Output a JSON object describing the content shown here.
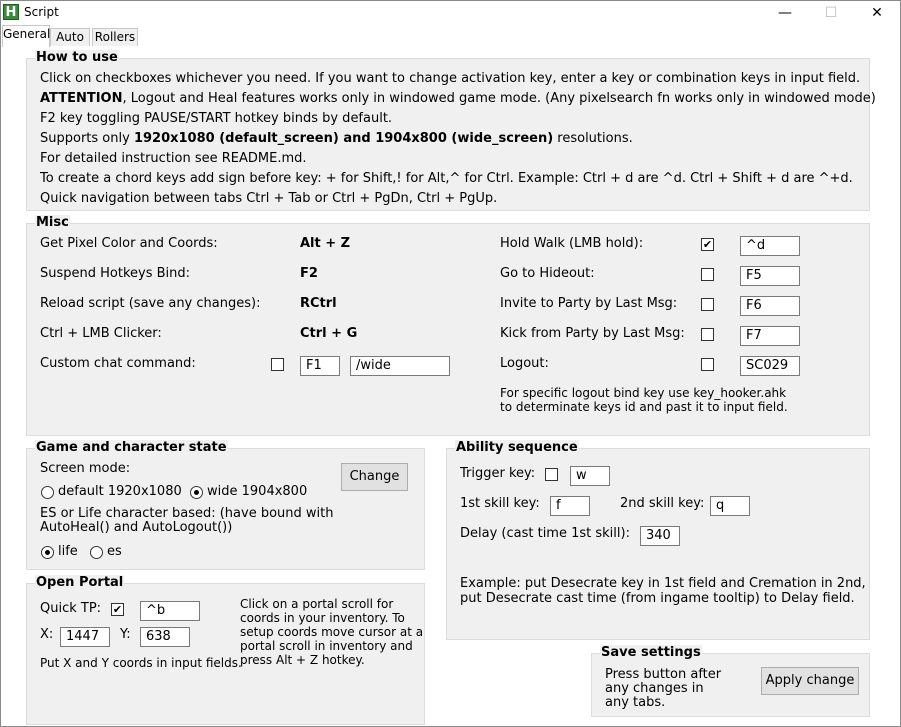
{
  "window": {
    "title": "Script",
    "app_icon_letter": "H",
    "minimize": "—",
    "maximize": "☐",
    "close": "✕"
  },
  "tabs": [
    "General",
    "Auto",
    "Rollers"
  ],
  "how_to_use": {
    "title": "How to use",
    "line1": "Click on checkboxes whichever you need. If you want to change activation key, enter a key or combination keys in input field.",
    "line2_bold": "ATTENTION",
    "line2_rest": ", Logout and Heal features works only in windowed game mode. (Any pixelsearch fn works only in windowed mode)",
    "line3": "F2 key toggling PAUSE/START hotkey binds by default.",
    "line4_a": "Supports only ",
    "line4_b": "1920x1080 (default_screen) and 1904x800 (wide_screen)",
    "line4_c": " resolutions.",
    "line5": "For detailed instruction see README.md.",
    "line6": "To create a chord keys add sign before key: + for Shift,! for Alt,^ for Ctrl. Example: Ctrl + d are ^d. Ctrl + Shift + d are ^+d.",
    "line7": "Quick navigation between tabs Ctrl + Tab or Ctrl + PgDn, Ctrl + PgUp."
  },
  "misc": {
    "title": "Misc",
    "get_pixel_label": "Get Pixel Color and Coords:",
    "get_pixel_key": "Alt + Z",
    "suspend_label": "Suspend Hotkeys Bind:",
    "suspend_key": "F2",
    "reload_label": "Reload script (save any changes):",
    "reload_key": "RCtrl",
    "clicker_label": "Ctrl + LMB Clicker:",
    "clicker_key": "Ctrl + G",
    "custom_chat_label": "Custom chat command:",
    "custom_chat_checked": false,
    "custom_chat_key": "F1",
    "custom_chat_cmd": "/wide",
    "hold_walk_label": "Hold Walk (LMB hold):",
    "hold_walk_checked": true,
    "hold_walk_key": "^d",
    "hideout_label": "Go to Hideout:",
    "hideout_checked": false,
    "hideout_key": "F5",
    "invite_label": "Invite to Party by Last Msg:",
    "invite_checked": false,
    "invite_key": "F6",
    "kick_label": "Kick from Party by Last Msg:",
    "kick_checked": false,
    "kick_key": "F7",
    "logout_label": "Logout:",
    "logout_checked": false,
    "logout_key": "SC029",
    "logout_note1": "For specific logout bind key use key_hooker.ahk",
    "logout_note2": "to determinate keys id and past it to input field."
  },
  "game_state": {
    "title": "Game and character state",
    "screen_mode_label": "Screen mode:",
    "default_label": "default 1920x1080",
    "wide_label": "wide 1904x800",
    "selected_screen": "wide",
    "change_button": "Change",
    "es_life_line1": "ES or Life character based: (have bound with",
    "es_life_line2": "AutoHeal() and AutoLogout())",
    "life_label": "life",
    "es_label": "es",
    "selected_char": "life"
  },
  "ability": {
    "title": "Ability sequence",
    "trigger_label": "Trigger key:",
    "trigger_checked": false,
    "trigger_key": "w",
    "skill1_label": "1st skill key:",
    "skill1_key": "f",
    "skill2_label": "2nd skill key:",
    "skill2_key": "q",
    "delay_label": "Delay (cast time 1st skill):",
    "delay_value": "340",
    "example_line1": "Example: put Desecrate key in 1st field and Cremation in 2nd,",
    "example_line2": "put Desecrate cast time (from ingame tooltip) to Delay field."
  },
  "portal": {
    "title": "Open Portal",
    "quick_tp_label": "Quick TP:",
    "quick_tp_checked": true,
    "quick_tp_key": "^b",
    "x_label": "X:",
    "x_value": "1447",
    "y_label": "Y:",
    "y_value": "638",
    "note1": "Click on a portal scroll for",
    "note2": "coords in your inventory. To",
    "note3": "setup coords move cursor at a",
    "note4": "portal scroll in inventory and",
    "note5": "press Alt + Z hotkey.",
    "xy_note": "Put X and Y coords in input fields."
  },
  "save": {
    "title": "Save settings",
    "text1": "Press button after",
    "text2": "any changes in",
    "text3": "any tabs.",
    "apply_button": "Apply change"
  }
}
